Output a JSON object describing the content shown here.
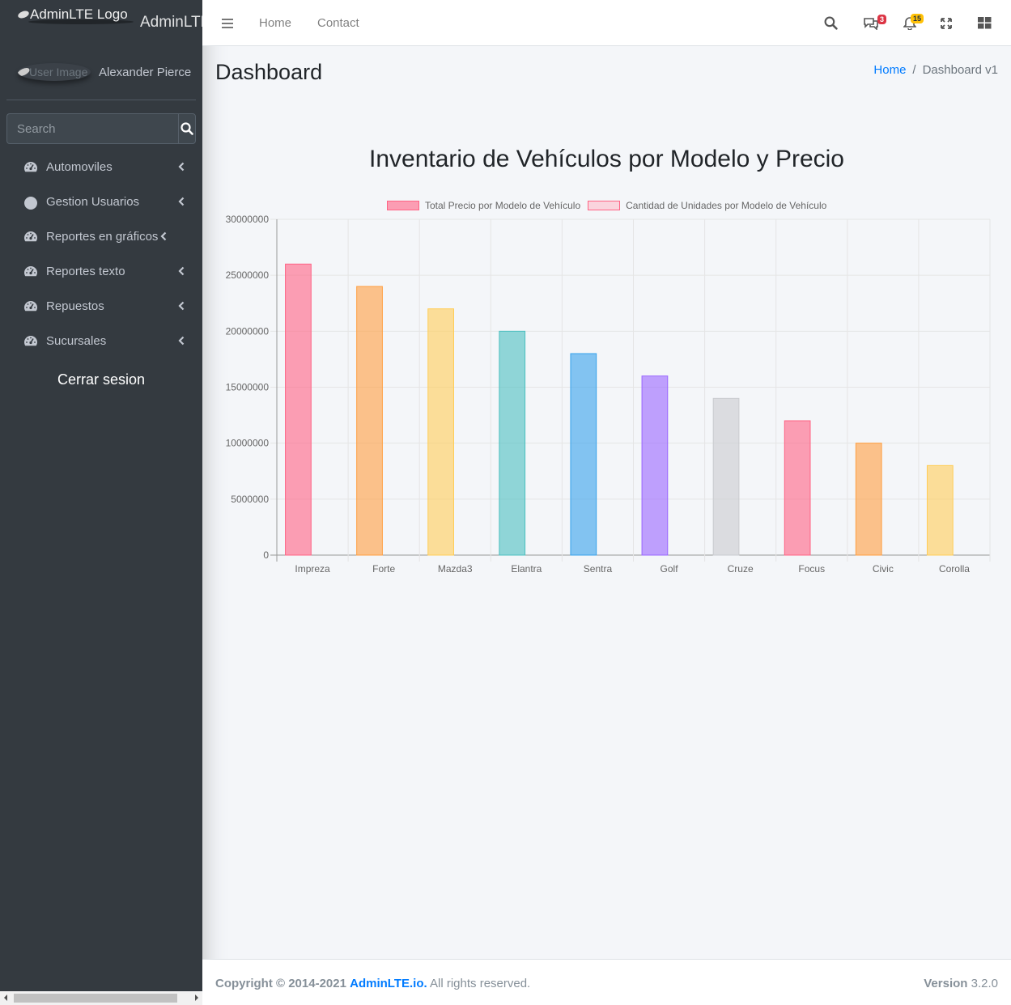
{
  "brand": {
    "logo_alt": "AdminLTE Logo",
    "name": "AdminLTE"
  },
  "user": {
    "image_alt": "User Image",
    "name": "Alexander Pierce"
  },
  "sidebar_search": {
    "placeholder": "Search"
  },
  "sidebar": {
    "items": [
      {
        "label": "Automoviles",
        "icon": "tachometer-icon"
      },
      {
        "label": "Gestion Usuarios",
        "icon": "circle-icon"
      },
      {
        "label": "Reportes en gráficos",
        "icon": "tachometer-icon"
      },
      {
        "label": "Reportes texto",
        "icon": "tachometer-icon"
      },
      {
        "label": "Repuestos",
        "icon": "tachometer-icon"
      },
      {
        "label": "Sucursales",
        "icon": "tachometer-icon"
      }
    ],
    "logout_label": "Cerrar sesion"
  },
  "navbar": {
    "links": [
      "Home",
      "Contact"
    ],
    "messages_badge": "3",
    "notifications_badge": "15",
    "icons": [
      "bars-icon",
      "search-icon",
      "comments-icon",
      "bell-icon",
      "expand-icon",
      "grid-icon"
    ]
  },
  "page": {
    "title": "Dashboard",
    "breadcrumb": {
      "home": "Home",
      "separator": "/",
      "current": "Dashboard v1"
    }
  },
  "chart_data": {
    "type": "bar",
    "title": "Inventario de Vehículos por Modelo y Precio",
    "categories": [
      "Impreza",
      "Forte",
      "Mazda3",
      "Elantra",
      "Sentra",
      "Golf",
      "Cruze",
      "Focus",
      "Civic",
      "Corolla"
    ],
    "series": [
      {
        "name": "Total Precio por Modelo de Vehículo",
        "values": [
          26000000,
          24000000,
          22000000,
          20000000,
          18000000,
          16000000,
          14000000,
          12000000,
          10000000,
          8000000
        ],
        "colors": [
          "#ff6384",
          "#ff9f40",
          "#ffcd56",
          "#4bc0c0",
          "#36a2eb",
          "#9966ff",
          "#c9cbcf",
          "#ff6384",
          "#ff9f40",
          "#ffcd56"
        ]
      },
      {
        "name": "Cantidad de Unidades por Modelo de Vehículo",
        "values": [
          0,
          0,
          0,
          0,
          0,
          0,
          0,
          0,
          0,
          0
        ],
        "colors": [
          "#ffb1c1"
        ]
      }
    ],
    "yticks": [
      "0",
      "5000000",
      "10000000",
      "15000000",
      "20000000",
      "25000000",
      "30000000"
    ],
    "ylim": [
      0,
      30000000
    ],
    "grid": true,
    "legend_position": "top"
  },
  "footer": {
    "copyright": "Copyright © 2014-2021",
    "link_text": "AdminLTE.io.",
    "rights": "All rights reserved.",
    "version_label": "Version",
    "version_number": "3.2.0"
  }
}
